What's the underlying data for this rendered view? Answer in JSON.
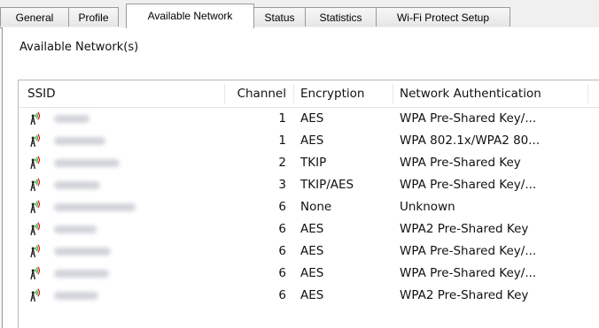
{
  "tabs": [
    {
      "label": "General"
    },
    {
      "label": "Profile"
    },
    {
      "label": "Available Network"
    },
    {
      "label": "Status"
    },
    {
      "label": "Statistics"
    },
    {
      "label": "Wi-Fi Protect Setup"
    }
  ],
  "active_tab": "Available Network",
  "section": {
    "label": "Available Network(s)"
  },
  "columns": {
    "ssid": "SSID",
    "channel": "Channel",
    "encryption": "Encryption",
    "auth": "Network Authentication"
  },
  "icons": {
    "network": "wifi-antenna-icon"
  },
  "networks": [
    {
      "channel": "1",
      "encryption": "AES",
      "auth": "WPA Pre-Shared Key/..."
    },
    {
      "channel": "1",
      "encryption": "AES",
      "auth": "WPA 802.1x/WPA2 80..."
    },
    {
      "channel": "2",
      "encryption": "TKIP",
      "auth": "WPA Pre-Shared Key"
    },
    {
      "channel": "3",
      "encryption": "TKIP/AES",
      "auth": "WPA Pre-Shared Key/..."
    },
    {
      "channel": "6",
      "encryption": "None",
      "auth": "Unknown"
    },
    {
      "channel": "6",
      "encryption": "AES",
      "auth": "WPA2 Pre-Shared Key"
    },
    {
      "channel": "6",
      "encryption": "AES",
      "auth": "WPA Pre-Shared Key/..."
    },
    {
      "channel": "6",
      "encryption": "AES",
      "auth": "WPA Pre-Shared Key/..."
    },
    {
      "channel": "6",
      "encryption": "AES",
      "auth": "WPA2 Pre-Shared Key"
    }
  ]
}
